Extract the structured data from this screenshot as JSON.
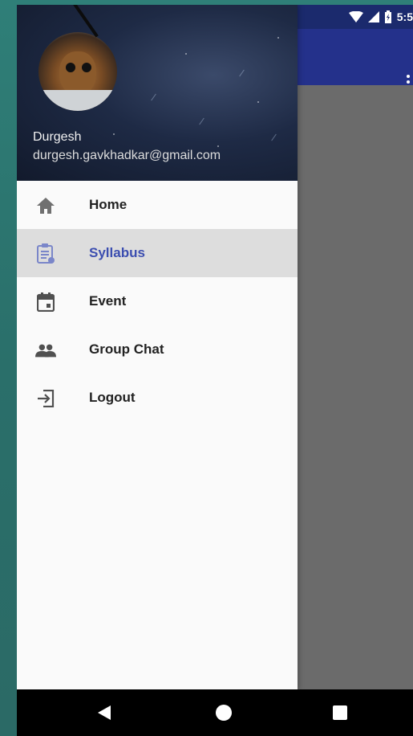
{
  "status_bar": {
    "time": "5:5"
  },
  "drawer": {
    "user": {
      "name": "Durgesh",
      "email": "durgesh.gavkhadkar@gmail.com"
    },
    "items": [
      {
        "label": "Home",
        "icon": "home-icon",
        "active": false
      },
      {
        "label": "Syllabus",
        "icon": "clipboard-icon",
        "active": true
      },
      {
        "label": "Event",
        "icon": "calendar-icon",
        "active": false
      },
      {
        "label": "Group Chat",
        "icon": "group-icon",
        "active": false
      },
      {
        "label": "Logout",
        "icon": "logout-icon",
        "active": false
      }
    ]
  },
  "colors": {
    "toolbar": "#24318b",
    "active_text": "#3c4eb0",
    "active_bg": "#dddddd"
  }
}
